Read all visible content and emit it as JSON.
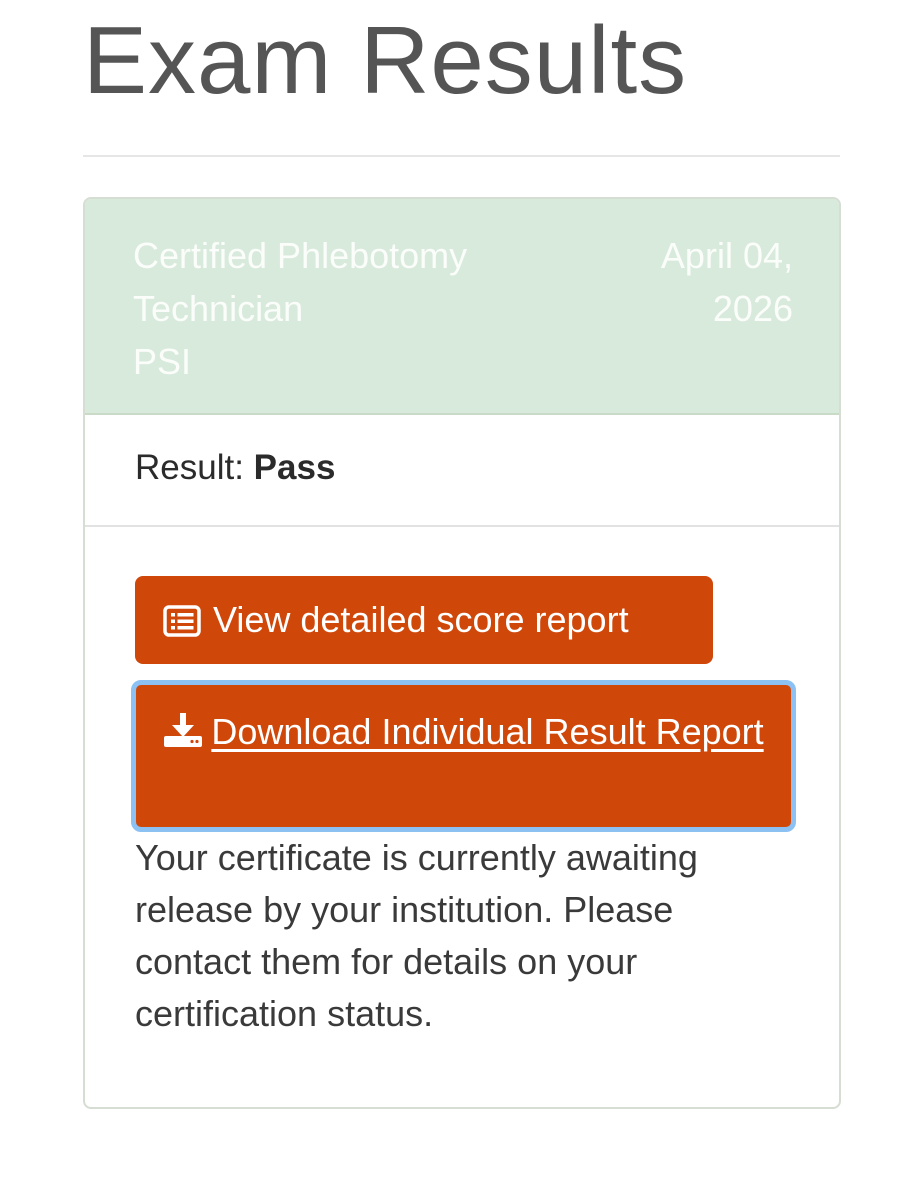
{
  "page": {
    "title": "Exam Results"
  },
  "exam": {
    "name": "Certified Phlebotomy Technician",
    "provider": "PSI",
    "date": "April 04, 2026",
    "result_label": "Result:",
    "result_value": "Pass"
  },
  "actions": {
    "score_report_label": "View detailed score report",
    "score_report_icon": "list-alt-icon",
    "download_label": "Download Individual Result Report",
    "download_icon": "download-icon"
  },
  "message": "Your certificate is currently awaiting release by your institution. Please contact them for details on your certification status.",
  "colors": {
    "header_bg": "#d8eadb",
    "button_bg": "#d0470a",
    "focus_ring": "#8cc2f3"
  }
}
